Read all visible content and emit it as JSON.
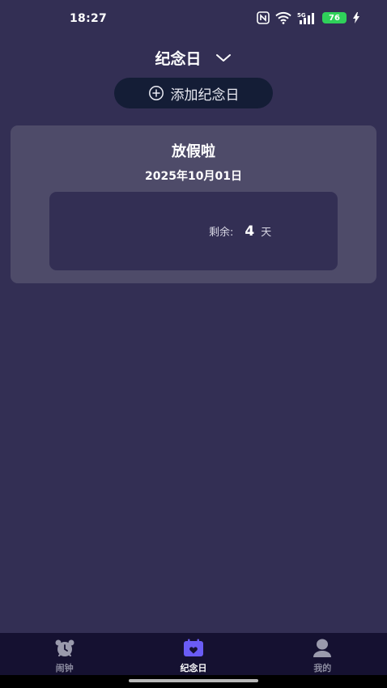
{
  "status_bar": {
    "time": "18:27",
    "battery": "76",
    "network": "5G",
    "icons": [
      "nfc-icon",
      "wifi-icon",
      "signal-icon",
      "battery-icon",
      "bolt-icon"
    ]
  },
  "header": {
    "title": "纪念日",
    "dropdown_icon": "chevron-down-icon"
  },
  "add_button": {
    "label": "添加纪念日",
    "icon": "plus-circle-icon"
  },
  "events": [
    {
      "title": "放假啦",
      "date": "2025年10月01日",
      "remaining_label": "剩余:",
      "remaining_value": "4",
      "remaining_unit": "天"
    }
  ],
  "bottom_nav": {
    "items": [
      {
        "label": "闹钟",
        "icon": "alarm-clock-icon",
        "active": false
      },
      {
        "label": "纪念日",
        "icon": "calendar-heart-icon",
        "active": true
      },
      {
        "label": "我的",
        "icon": "person-icon",
        "active": false
      }
    ]
  },
  "colors": {
    "background": "#332f54",
    "card": "#4e4b69",
    "add_button": "#141d36",
    "nav_background": "#151131",
    "active_icon": "#6a5cf5",
    "battery": "#2fd15a"
  }
}
